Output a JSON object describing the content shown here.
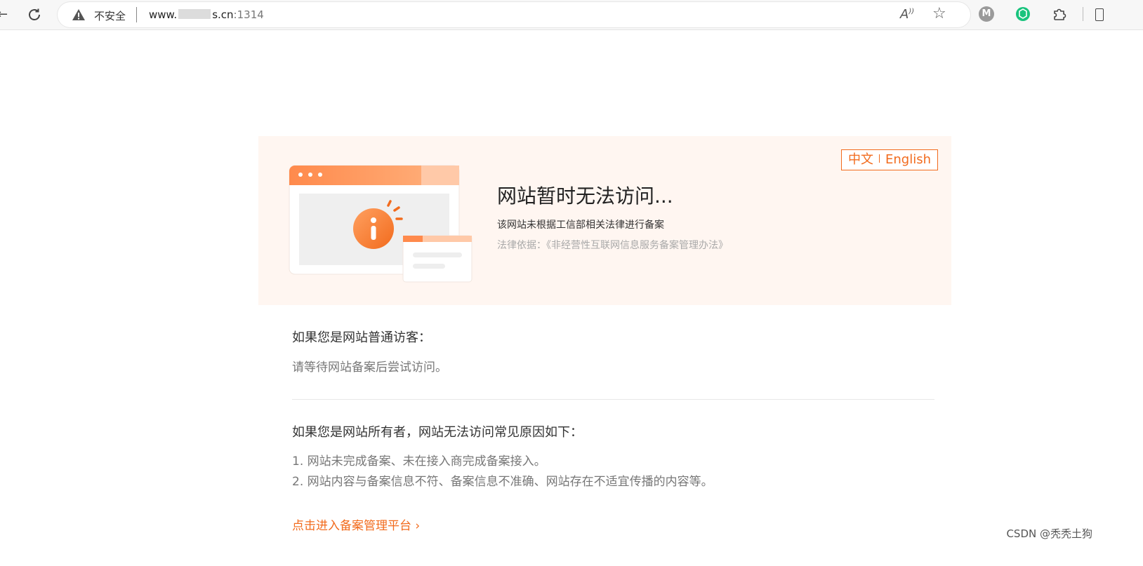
{
  "browser": {
    "security_label": "不安全",
    "url_prefix": "www.",
    "url_suffix": "s.cn",
    "url_port": ":1314"
  },
  "hero": {
    "lang_zh": "中文",
    "lang_en": "English",
    "title": "网站暂时无法访问...",
    "subtitle": "该网站未根据工信部相关法律进行备案",
    "legal_basis": "法律依据：《非经营性互联网信息服务备案管理办法》"
  },
  "visitor_section": {
    "heading": "如果您是网站普通访客：",
    "text": "请等待网站备案后尝试访问。"
  },
  "owner_section": {
    "heading": "如果您是网站所有者，网站无法访问常见原因如下：",
    "reasons": [
      "1. 网站未完成备案、未在接入商完成备案接入。",
      "2. 网站内容与备案信息不符、备案信息不准确、网站存在不适宜传播的内容等。"
    ]
  },
  "link": {
    "label": "点击进入备案管理平台 ›"
  },
  "watermark": "CSDN @秃秃土狗",
  "colors": {
    "accent": "#f26b1d",
    "hero_bg": "#fff6f1"
  },
  "icons": {
    "reload": "reload-icon",
    "warning": "warning-icon",
    "read_aloud": "read-aloud-icon",
    "favorite": "star-icon",
    "extension_m": "m-extension-icon",
    "extension_openai": "openai-extension-icon",
    "extensions": "puzzle-icon",
    "illustration": "info-illustration"
  }
}
